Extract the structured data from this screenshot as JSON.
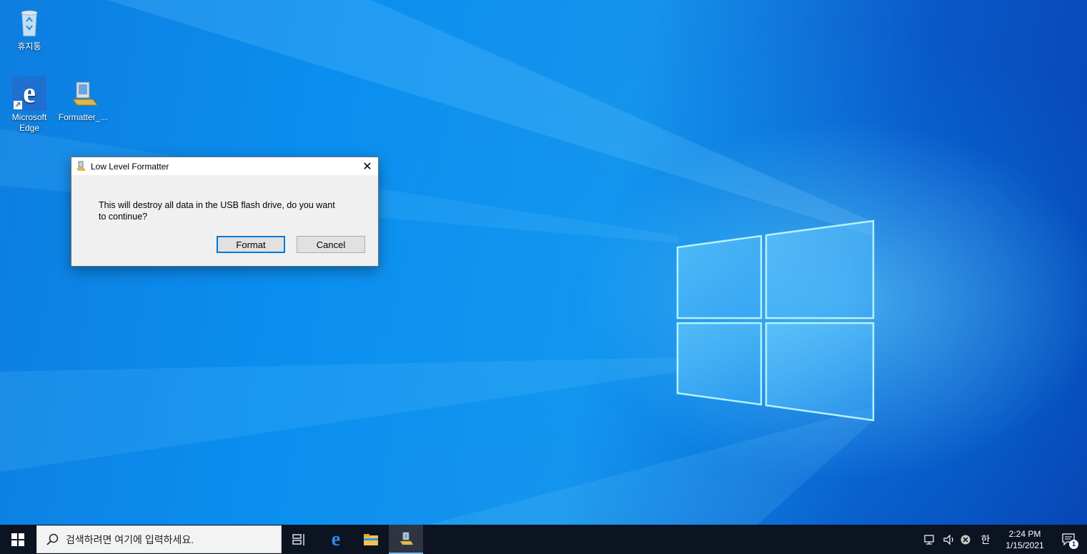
{
  "desktop": {
    "icons": [
      {
        "label": "휴지통",
        "icon": "recycle-bin-icon"
      },
      {
        "label": "Microsoft Edge",
        "icon": "edge-icon"
      },
      {
        "label": "Formatter_...",
        "icon": "formatter-app-icon"
      }
    ]
  },
  "dialog": {
    "title": "Low Level Formatter",
    "message": "This will destroy all data in the USB flash drive, do you want to continue?",
    "format_label": "Format",
    "cancel_label": "Cancel",
    "close_glyph": "✕"
  },
  "taskbar": {
    "search_placeholder": "검색하려면 여기에 입력하세요.",
    "pinned": [
      "task-view-icon",
      "edge-icon",
      "file-explorer-icon",
      "formatter-app-icon"
    ],
    "tray": {
      "ime_label": "한",
      "time": "2:24 PM",
      "date": "1/15/2021",
      "notification_count": "1"
    }
  },
  "colors": {
    "accent": "#0078d7",
    "taskbar": "#0c1421",
    "desktop_blue": "#0a8ff0"
  }
}
